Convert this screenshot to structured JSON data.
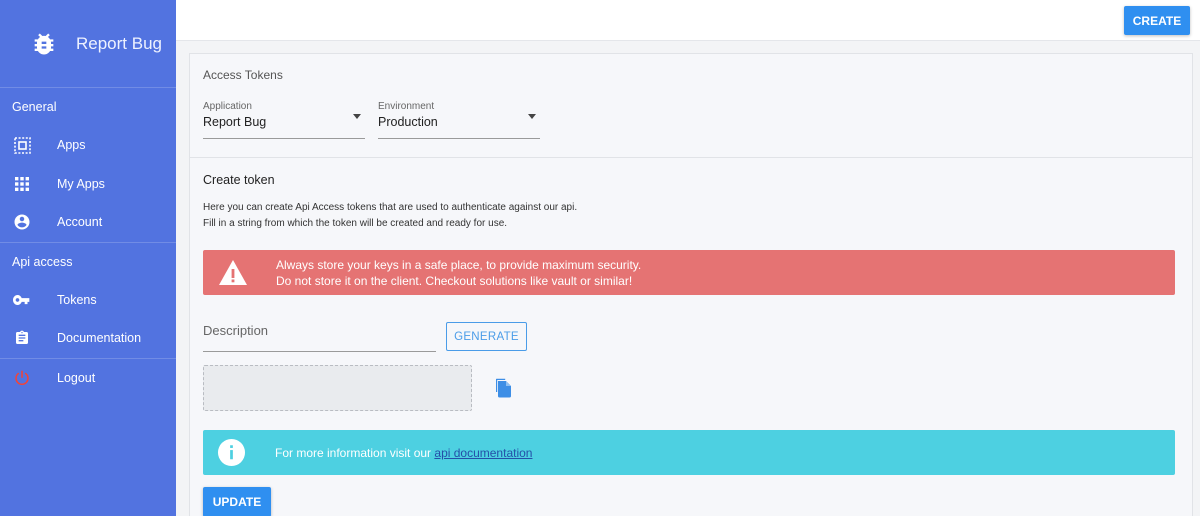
{
  "app": {
    "title": "Report Bug",
    "icon": "bug-icon"
  },
  "sidebar": {
    "sections": [
      {
        "label": "General",
        "items": [
          {
            "label": "Apps",
            "icon": "apps-grid-icon"
          },
          {
            "label": "My Apps",
            "icon": "dots-grid-icon"
          },
          {
            "label": "Account",
            "icon": "account-circle-icon"
          }
        ]
      },
      {
        "label": "Api access",
        "items": [
          {
            "label": "Tokens",
            "icon": "key-icon"
          },
          {
            "label": "Documentation",
            "icon": "clipboard-icon"
          },
          {
            "label": "Logout",
            "icon": "power-icon"
          }
        ]
      }
    ]
  },
  "topbar": {
    "create_label": "CREATE"
  },
  "card": {
    "title": "Access Tokens",
    "application": {
      "label": "Application",
      "value": "Report Bug"
    },
    "environment": {
      "label": "Environment",
      "value": "Production"
    },
    "create_token": {
      "title": "Create token",
      "help_line1": "Here you can create Api Access tokens that are used to authenticate against our api.",
      "help_line2": "Fill in a string from which the token will be created and ready for use."
    },
    "warning": {
      "line1": "Always store your keys in a safe place, to provide maximum security.",
      "line2": "Do not store it on the client. Checkout solutions like vault or similar!"
    },
    "description_placeholder": "Description",
    "generate_label": "GENERATE",
    "token_value": "",
    "info": {
      "text": "For more information visit our ",
      "link": "api documentation"
    },
    "update_label": "UPDATE"
  },
  "colors": {
    "sidebar": "#5273e0",
    "primary": "#2f8ff0",
    "danger": "#e57373",
    "info": "#4dd0e1",
    "logout": "#f44336"
  }
}
